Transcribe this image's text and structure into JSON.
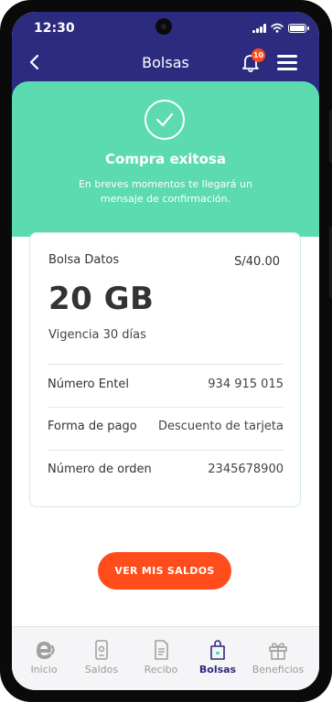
{
  "status_bar": {
    "time": "12:30"
  },
  "header": {
    "title": "Bolsas",
    "notification_count": "10"
  },
  "success": {
    "title": "Compra exitosa",
    "message": "En breves momentos te llegará un mensaje de confirmación."
  },
  "card": {
    "label": "Bolsa Datos",
    "price": "S/40.00",
    "size": "20 GB",
    "validity": "Vigencia 30 días",
    "rows": [
      {
        "label": "Número Entel",
        "value": "934 915 015"
      },
      {
        "label": "Forma de pago",
        "value": "Descuento de tarjeta"
      },
      {
        "label": "Número de orden",
        "value": "2345678900"
      }
    ]
  },
  "cta": {
    "label": "VER MIS SALDOS"
  },
  "bottom_nav": [
    {
      "label": "Inicio",
      "icon": "entel-logo-icon"
    },
    {
      "label": "Saldos",
      "icon": "phone-icon"
    },
    {
      "label": "Recibo",
      "icon": "receipt-icon"
    },
    {
      "label": "Bolsas",
      "icon": "bag-icon",
      "active": true
    },
    {
      "label": "Beneficios",
      "icon": "gift-icon"
    }
  ],
  "colors": {
    "brand_navy": "#2d2b7f",
    "success_green": "#5cdbb0",
    "accent_orange": "#ff4c1a"
  }
}
